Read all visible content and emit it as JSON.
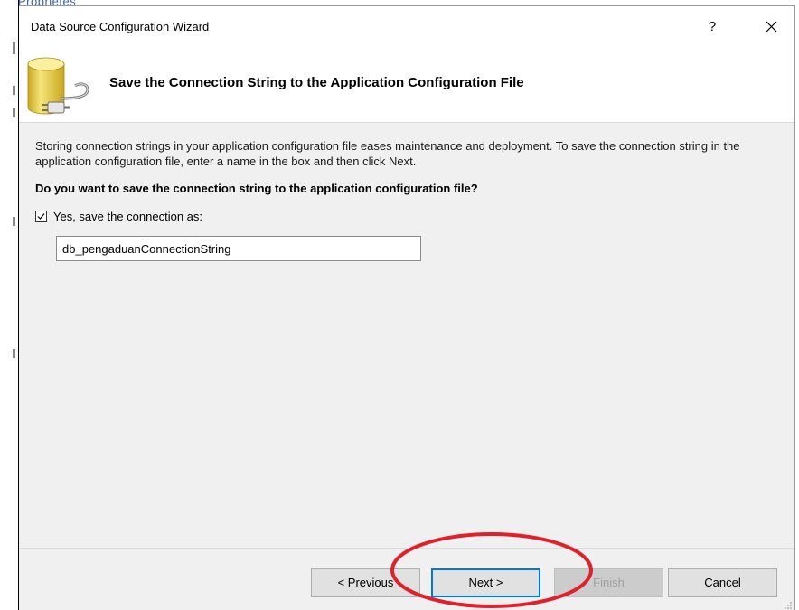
{
  "background": {
    "peek_text": "Proprietes"
  },
  "dialog": {
    "title": "Data Source Configuration Wizard",
    "help_label": "?",
    "header_title": "Save the Connection String to the Application Configuration File",
    "description": "Storing connection strings in your application configuration file eases maintenance and deployment. To save the connection string in the application configuration file, enter a name in the box and then click Next.",
    "question": "Do you want to save the connection string to the application configuration file?",
    "checkbox": {
      "label": "Yes, save the connection as:",
      "checked": true
    },
    "connection_name_input": {
      "value": "db_pengaduanConnectionString"
    }
  },
  "buttons": {
    "previous": "< Previous",
    "next": "Next >",
    "finish": "Finish",
    "cancel": "Cancel"
  },
  "colors": {
    "dialog_bg": "#f0f0f0",
    "focus_border": "#0078d7",
    "annotation": "#e0202a",
    "db_icon": "#e8d14a"
  },
  "icons": {
    "help": "question-mark-icon",
    "close": "close-icon",
    "header": "database-connection-icon",
    "resize": "resize-grip-icon"
  }
}
